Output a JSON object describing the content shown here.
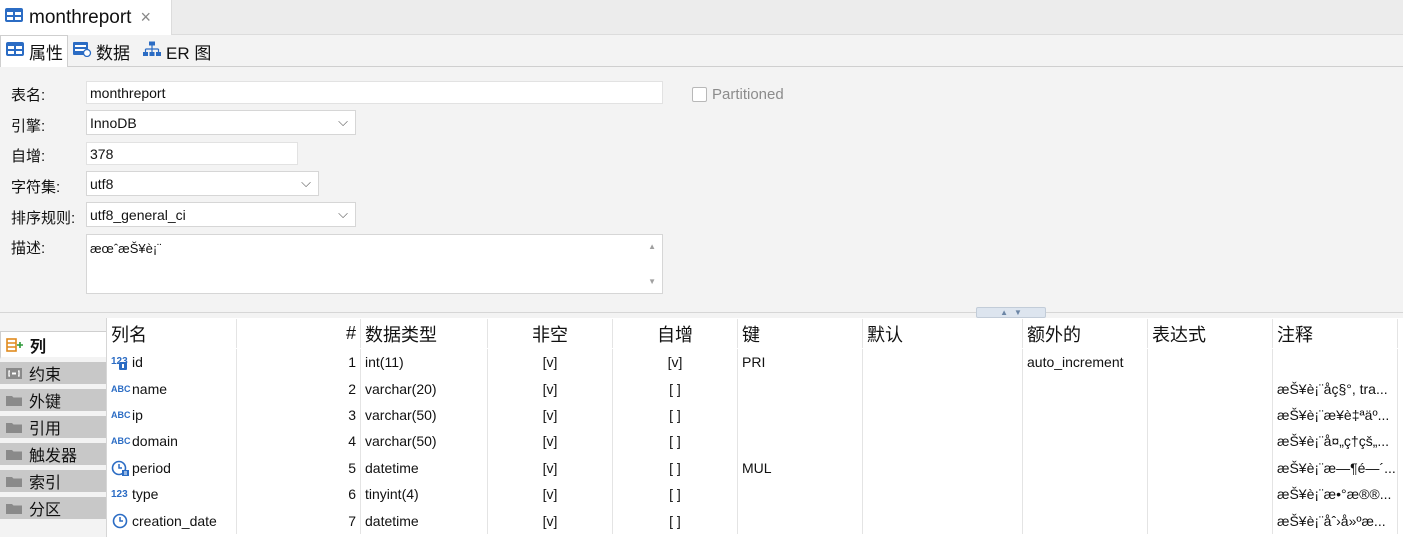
{
  "editor_tab": {
    "title": "monthreport",
    "close_glyph": "×",
    "icon": "table-icon"
  },
  "view_tabs": [
    {
      "label": "属性",
      "icon": "table-icon",
      "active": true
    },
    {
      "label": "数据",
      "icon": "data-grid-icon",
      "active": false
    },
    {
      "label": "ER 图",
      "icon": "er-diagram-icon",
      "active": false
    }
  ],
  "properties": {
    "table_name_label": "表名:",
    "table_name": "monthreport",
    "engine_label": "引擎:",
    "engine": "InnoDB",
    "auto_inc_label": "自增:",
    "auto_inc": "378",
    "charset_label": "字符集:",
    "charset": "utf8",
    "collation_label": "排序规则:",
    "collation": "utf8_general_ci",
    "description_label": "描述:",
    "description": "æœˆæŠ¥è¡¨",
    "partitioned_label": "Partitioned",
    "partitioned": false
  },
  "side_tabs": [
    {
      "label": "列",
      "icon": "columns-add-icon",
      "active": true
    },
    {
      "label": "约束",
      "icon": "constraint-icon",
      "active": false
    },
    {
      "label": "外键",
      "icon": "folder-icon",
      "active": false
    },
    {
      "label": "引用",
      "icon": "folder-icon",
      "active": false
    },
    {
      "label": "触发器",
      "icon": "folder-icon",
      "active": false
    },
    {
      "label": "索引",
      "icon": "folder-icon",
      "active": false
    },
    {
      "label": "分区",
      "icon": "folder-icon",
      "active": false
    }
  ],
  "grid": {
    "headers": {
      "name": "列名",
      "num": "#",
      "type": "数据类型",
      "notnull": "非空",
      "autoinc": "自增",
      "key": "键",
      "default": "默认",
      "extra": "额外的",
      "expr": "表达式",
      "comment": "注释"
    },
    "rows": [
      {
        "icon": "number-key-icon",
        "name": "id",
        "num": "1",
        "type": "int(11)",
        "notnull": "[v]",
        "autoinc": "[v]",
        "key": "PRI",
        "default": "",
        "extra": "auto_increment",
        "expr": "",
        "comment": ""
      },
      {
        "icon": "string-icon",
        "name": "name",
        "num": "2",
        "type": "varchar(20)",
        "notnull": "[v]",
        "autoinc": "[ ]",
        "key": "",
        "default": "",
        "extra": "",
        "expr": "",
        "comment": "æŠ¥è¡¨åç§°, tra..."
      },
      {
        "icon": "string-icon",
        "name": "ip",
        "num": "3",
        "type": "varchar(50)",
        "notnull": "[v]",
        "autoinc": "[ ]",
        "key": "",
        "default": "",
        "extra": "",
        "expr": "",
        "comment": "æŠ¥è¡¨æ¥è‡ªäº..."
      },
      {
        "icon": "string-icon",
        "name": "domain",
        "num": "4",
        "type": "varchar(50)",
        "notnull": "[v]",
        "autoinc": "[ ]",
        "key": "",
        "default": "",
        "extra": "",
        "expr": "",
        "comment": "æŠ¥è¡¨å¤„ç†çš„..."
      },
      {
        "icon": "datetime-index-icon",
        "name": "period",
        "num": "5",
        "type": "datetime",
        "notnull": "[v]",
        "autoinc": "[ ]",
        "key": "MUL",
        "default": "",
        "extra": "",
        "expr": "",
        "comment": "æŠ¥è¡¨æ—¶é—´..."
      },
      {
        "icon": "number-icon",
        "name": "type",
        "num": "6",
        "type": "tinyint(4)",
        "notnull": "[v]",
        "autoinc": "[ ]",
        "key": "",
        "default": "",
        "extra": "",
        "expr": "",
        "comment": "æŠ¥è¡¨æ•°æ®®..."
      },
      {
        "icon": "clock-icon",
        "name": "creation_date",
        "num": "7",
        "type": "datetime",
        "notnull": "[v]",
        "autoinc": "[ ]",
        "key": "",
        "default": "",
        "extra": "",
        "expr": "",
        "comment": "æŠ¥è¡¨åˆ›å»ºæ..."
      }
    ]
  },
  "colors": {
    "icon_blue": "#2b6cc4",
    "folder_gray": "#8a8a8a",
    "add_orange": "#e08a1e"
  }
}
